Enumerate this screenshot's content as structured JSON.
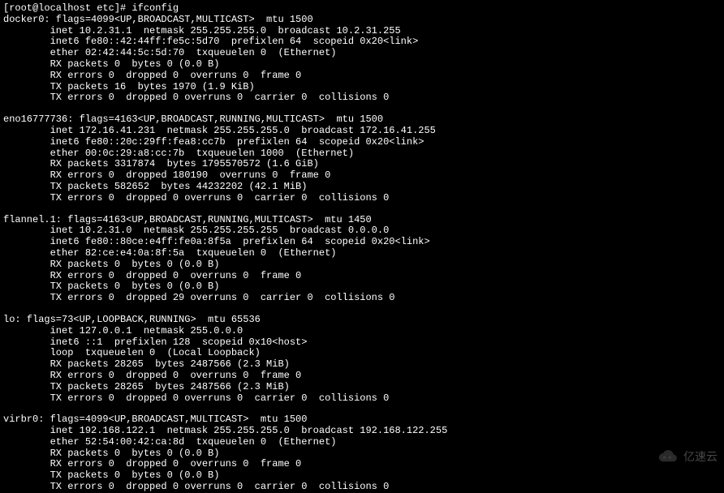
{
  "prompt": {
    "user": "root",
    "host": "localhost",
    "cwd": "etc",
    "symbol": "#",
    "command": "ifconfig"
  },
  "interfaces": [
    {
      "name": "docker0",
      "flags_num": "4099",
      "flags": "UP,BROADCAST,MULTICAST",
      "mtu": "1500",
      "inet": "10.2.31.1",
      "netmask": "255.255.255.0",
      "broadcast": "10.2.31.255",
      "inet6": "fe80::42:44ff:fe5c:5d70",
      "prefixlen": "64",
      "scopeid": "0x20<link>",
      "ether": "02:42:44:5c:5d:70",
      "txqueuelen": "0",
      "link_type": "Ethernet",
      "rx_packets": "0",
      "rx_bytes": "0",
      "rx_bytes_human": "0.0 B",
      "rx_errors": "0",
      "rx_dropped": "0",
      "rx_overruns": "0",
      "rx_frame": "0",
      "tx_packets": "16",
      "tx_bytes": "1970",
      "tx_bytes_human": "1.9 KiB",
      "tx_errors": "0",
      "tx_dropped": "0",
      "tx_overruns": "0",
      "tx_carrier": "0",
      "tx_collisions": "0"
    },
    {
      "name": "eno16777736",
      "flags_num": "4163",
      "flags": "UP,BROADCAST,RUNNING,MULTICAST",
      "mtu": "1500",
      "inet": "172.16.41.231",
      "netmask": "255.255.255.0",
      "broadcast": "172.16.41.255",
      "inet6": "fe80::20c:29ff:fea8:cc7b",
      "prefixlen": "64",
      "scopeid": "0x20<link>",
      "ether": "00:0c:29:a8:cc:7b",
      "txqueuelen": "1000",
      "link_type": "Ethernet",
      "rx_packets": "3317874",
      "rx_bytes": "1795570572",
      "rx_bytes_human": "1.6 GiB",
      "rx_errors": "0",
      "rx_dropped": "180190",
      "rx_overruns": "0",
      "rx_frame": "0",
      "tx_packets": "582652",
      "tx_bytes": "44232202",
      "tx_bytes_human": "42.1 MiB",
      "tx_errors": "0",
      "tx_dropped": "0",
      "tx_overruns": "0",
      "tx_carrier": "0",
      "tx_collisions": "0"
    },
    {
      "name": "flannel.1",
      "flags_num": "4163",
      "flags": "UP,BROADCAST,RUNNING,MULTICAST",
      "mtu": "1450",
      "inet": "10.2.31.0",
      "netmask": "255.255.255.255",
      "broadcast": "0.0.0.0",
      "inet6": "fe80::80ce:e4ff:fe0a:8f5a",
      "prefixlen": "64",
      "scopeid": "0x20<link>",
      "ether": "82:ce:e4:0a:8f:5a",
      "txqueuelen": "0",
      "link_type": "Ethernet",
      "rx_packets": "0",
      "rx_bytes": "0",
      "rx_bytes_human": "0.0 B",
      "rx_errors": "0",
      "rx_dropped": "0",
      "rx_overruns": "0",
      "rx_frame": "0",
      "tx_packets": "0",
      "tx_bytes": "0",
      "tx_bytes_human": "0.0 B",
      "tx_errors": "0",
      "tx_dropped": "29",
      "tx_overruns": "0",
      "tx_carrier": "0",
      "tx_collisions": "0"
    },
    {
      "name": "lo",
      "flags_num": "73",
      "flags": "UP,LOOPBACK,RUNNING",
      "mtu": "65536",
      "inet": "127.0.0.1",
      "netmask": "255.0.0.0",
      "broadcast": "",
      "inet6": "::1",
      "prefixlen": "128",
      "scopeid": "0x10<host>",
      "ether": "",
      "loop": "loop",
      "txqueuelen": "0",
      "link_type": "Local Loopback",
      "rx_packets": "28265",
      "rx_bytes": "2487566",
      "rx_bytes_human": "2.3 MiB",
      "rx_errors": "0",
      "rx_dropped": "0",
      "rx_overruns": "0",
      "rx_frame": "0",
      "tx_packets": "28265",
      "tx_bytes": "2487566",
      "tx_bytes_human": "2.3 MiB",
      "tx_errors": "0",
      "tx_dropped": "0",
      "tx_overruns": "0",
      "tx_carrier": "0",
      "tx_collisions": "0"
    },
    {
      "name": "virbr0",
      "flags_num": "4099",
      "flags": "UP,BROADCAST,MULTICAST",
      "mtu": "1500",
      "inet": "192.168.122.1",
      "netmask": "255.255.255.0",
      "broadcast": "192.168.122.255",
      "inet6": "",
      "prefixlen": "",
      "scopeid": "",
      "ether": "52:54:00:42:ca:8d",
      "txqueuelen": "0",
      "link_type": "Ethernet",
      "rx_packets": "0",
      "rx_bytes": "0",
      "rx_bytes_human": "0.0 B",
      "rx_errors": "0",
      "rx_dropped": "0",
      "rx_overruns": "0",
      "rx_frame": "0",
      "tx_packets": "0",
      "tx_bytes": "0",
      "tx_bytes_human": "0.0 B",
      "tx_errors": "0",
      "tx_dropped": "0",
      "tx_overruns": "0",
      "tx_carrier": "0",
      "tx_collisions": "0"
    }
  ],
  "watermark": {
    "text": "亿速云"
  }
}
